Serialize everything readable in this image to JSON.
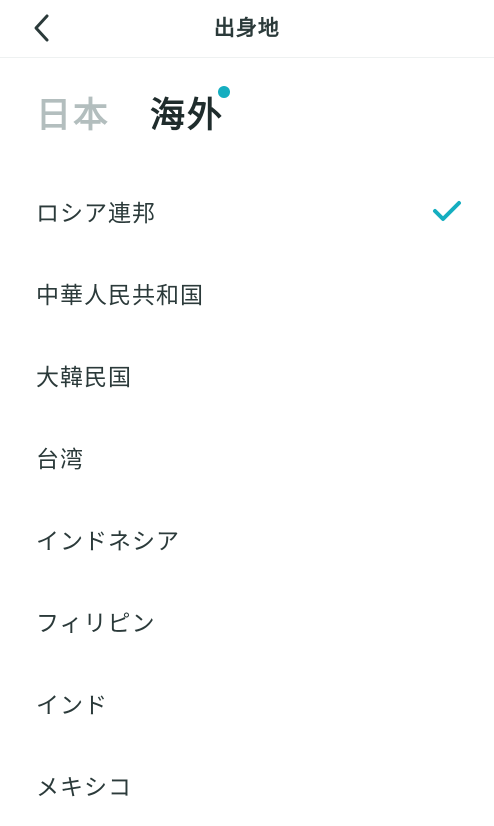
{
  "header": {
    "title": "出身地",
    "back_icon": "chevron-left-icon"
  },
  "tabs": [
    {
      "label": "日本",
      "active": false
    },
    {
      "label": "海外",
      "active": true,
      "has_dot": true
    }
  ],
  "colors": {
    "accent": "#15aec0",
    "text": "#2b3a3a",
    "inactive_tab": "#b3bebe"
  },
  "countries": [
    {
      "label": "ロシア連邦",
      "selected": true
    },
    {
      "label": "中華人民共和国",
      "selected": false
    },
    {
      "label": "大韓民国",
      "selected": false
    },
    {
      "label": "台湾",
      "selected": false
    },
    {
      "label": "インドネシア",
      "selected": false
    },
    {
      "label": "フィリピン",
      "selected": false
    },
    {
      "label": "インド",
      "selected": false
    },
    {
      "label": "メキシコ",
      "selected": false
    }
  ]
}
